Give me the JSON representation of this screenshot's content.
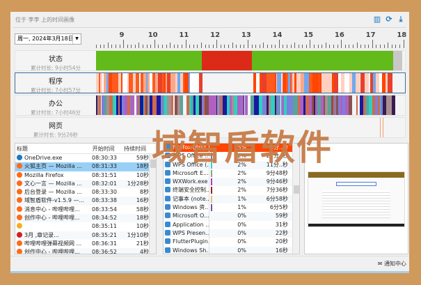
{
  "title": "位于 李李 上的时间画像",
  "date": "周一, 2024年3月18日",
  "hours": [
    "9",
    "10",
    "11",
    "12",
    "13",
    "14",
    "15",
    "16",
    "17",
    "18"
  ],
  "rows": [
    {
      "name": "状态",
      "sub": "累计时长: 9小时54分"
    },
    {
      "name": "程序",
      "sub": "累计时长: 7小时57分"
    },
    {
      "name": "办公",
      "sub": "累计时长: 7小时46分"
    },
    {
      "name": "网页",
      "sub": "累计时长: 9分26秒"
    }
  ],
  "colors": {
    "green": "#62bb1a",
    "red": "#dc2a18",
    "gray": "#c8c8c8",
    "accent": "#1a78c2",
    "watermark": "#c77c48",
    "prog": [
      "#ff4500",
      "#ff5a1f",
      "#f7a98a",
      "#ffd0c0",
      "#e8402a",
      "#6fa8f0",
      "#fff"
    ],
    "office": [
      "#7b7fdc",
      "#59a39c",
      "#a89090",
      "#d06a4a",
      "#b060c0",
      "#2fd0c0",
      "#3a1a50",
      "#8a5050",
      "#1818a0",
      "#f4f4f4"
    ]
  },
  "table1": {
    "headers": [
      "标题",
      "开始时间",
      "持续时间"
    ],
    "rows": [
      [
        "OneDrive.exe",
        "08:30:33",
        "59秒"
      ],
      [
        "火狐主页 — Mozilla ...",
        "08:31:33",
        "18秒"
      ],
      [
        "Mozilla Firefox",
        "08:31:51",
        "10秒"
      ],
      [
        "文心一言 — Mozilla ...",
        "08:32:01",
        "1分28秒"
      ],
      [
        "后台登录 — Mozilla ...",
        "08:33:30",
        "8秒"
      ],
      [
        "域智盾软件-v1.5.9 —...",
        "08:33:38",
        "16秒"
      ],
      [
        "消息中心 - 哔哩哔哩...",
        "08:33:54",
        "58秒"
      ],
      [
        "创作中心 - 哔哩哔哩...",
        "08:34:52",
        "18秒"
      ],
      [
        "",
        "08:35:11",
        "10秒"
      ],
      [
        "3月          ,章记录...",
        "08:35:21",
        "1分10秒"
      ],
      [
        "哔哩哔哩弹幕视频网 ...",
        "08:36:31",
        "21秒"
      ],
      [
        "创作中心 - 哔哩哔哩...",
        "08:36:52",
        "4秒"
      ]
    ]
  },
  "table2": {
    "rows": [
      [
        "Firefox (firef...",
        "5%",
        "6分..秒"
      ],
      [
        "WPS Office ...",
        "2%",
        "2..分..秒"
      ],
      [
        "WPS Office (...",
        "2%",
        "11分..秒"
      ],
      [
        "Microsoft E...",
        "2%",
        "9分48秒"
      ],
      [
        "WXWork.exe",
        "2%",
        "9分46秒"
      ],
      [
        "终端安全控制...",
        "2%",
        "7分36秒"
      ],
      [
        "记事本 (note...",
        "1%",
        "6分58秒"
      ],
      [
        "Windows 资...",
        "1%",
        "6分5秒"
      ],
      [
        "Microsoft O...",
        "0%",
        "59秒"
      ],
      [
        "Application ...",
        "0%",
        "31秒"
      ],
      [
        "WPS Presen...",
        "0%",
        "22秒"
      ],
      [
        "FlutterPlugin...",
        "0%",
        "20秒"
      ],
      [
        "Windows Sh...",
        "0%",
        "16秒"
      ]
    ]
  },
  "status": {
    "notify": "通知中心"
  },
  "watermark": "域智盾软件"
}
